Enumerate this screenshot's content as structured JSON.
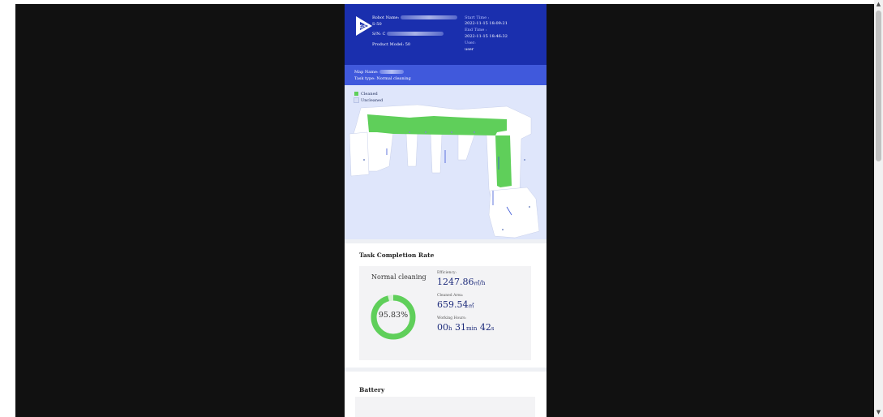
{
  "robot": {
    "name_label": "Robot Name:",
    "model_code": "S-50",
    "sn_label": "S/N: C",
    "product_model": "Product Model: 50"
  },
  "task_time": {
    "start_label": "Start Time :",
    "start_value": "2022-11-15 18:09:21",
    "end_label": "End Time :",
    "end_value": "2022-11-15 18:46:32",
    "user_label": "User:",
    "user_value": "user"
  },
  "map_info": {
    "map_name_label": "Map Name:",
    "task_type": "Task type: Normal cleaning"
  },
  "legend": {
    "cleaned": "Cleaned",
    "uncleaned": "Uncleaned",
    "cleaned_color": "#5fcf5a",
    "uncleaned_color": "#dfe6fb"
  },
  "completion": {
    "title": "Task Completion Rate",
    "mode": "Normal cleaning",
    "percent_text": "95.83%",
    "percent_value": 95.83,
    "efficiency_label": "Efficiency:",
    "efficiency_value": "1247.86",
    "efficiency_unit": "㎡/h",
    "area_label": "Cleaned Area:",
    "area_value": "659.54",
    "area_unit": "㎡",
    "hours_label": "Working Hours:",
    "hours_h": "00",
    "hours_h_unit": "h",
    "hours_min": "31",
    "hours_min_unit": "min",
    "hours_s": "42",
    "hours_s_unit": "s"
  },
  "battery": {
    "title": "Battery"
  },
  "colors": {
    "header_bg": "#1a2fae",
    "mapinfo_bg": "#4059dc",
    "accent_green": "#5fcf5a",
    "value_text": "#1c2a7a"
  },
  "icons": {
    "logo": "gs-logo-icon",
    "scroll_up": "scroll-up-arrow-icon",
    "scroll_down": "scroll-down-arrow-icon"
  }
}
